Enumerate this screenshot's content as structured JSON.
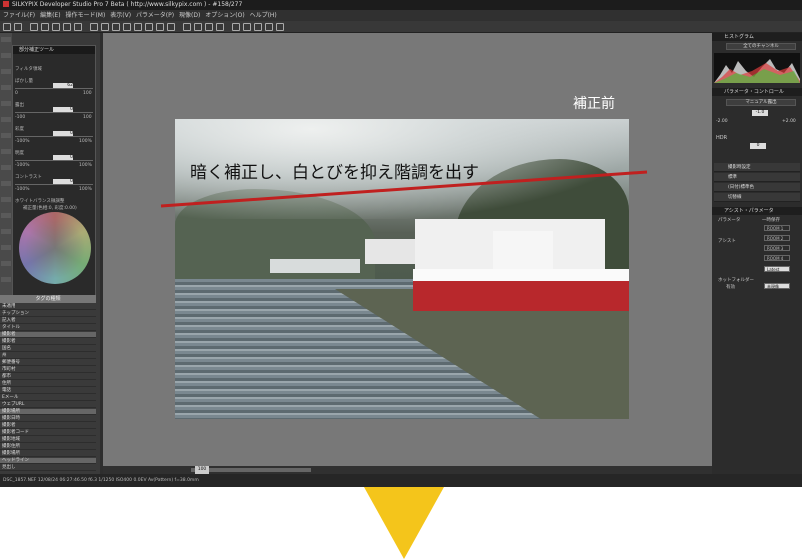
{
  "window": {
    "title": "SILKYPIX Developer Studio Pro 7 Beta ( http://www.silkypix.com ) - #158/277"
  },
  "menu": [
    "ファイル(F)",
    "編集(E)",
    "操作モード(M)",
    "表示(V)",
    "パラメータ(P)",
    "現像(D)",
    "オプション(O)",
    "ヘルプ(H)"
  ],
  "left_panel": {
    "title": "部分補正ツール",
    "filter_label": "フィルタ領域",
    "sliders": [
      {
        "label": "ぼかし量",
        "value": "62",
        "min": "0",
        "max": "100"
      },
      {
        "label": "露出",
        "value": "0",
        "min": "-100",
        "max": "100"
      },
      {
        "label": "彩度",
        "value": "0",
        "min": "-100%",
        "max": "100%"
      },
      {
        "label": "明度",
        "value": "0",
        "min": "-100%",
        "max": "100%"
      },
      {
        "label": "コントラスト",
        "value": "0",
        "min": "-100%",
        "max": "100%"
      }
    ],
    "wb_label": "ホワイトバランス微調整",
    "wb_value": "補正量(色相:0, 彩度:0.00)",
    "tag_header": "タグの種類",
    "tags": [
      "未適用",
      "チップション",
      "記入者",
      "タイトル",
      "撮影者",
      "撮影者",
      "国名",
      "州",
      "郵便番号",
      "市町村",
      "都市",
      "住所",
      "電話",
      "Eメール",
      "ウェブURL",
      "撮影場所",
      "撮影日時",
      "撮影者",
      "撮影者コード",
      "撮影地域",
      "撮影住所",
      "撮影場所",
      "ヘッドライン",
      "見出し"
    ]
  },
  "preview": {
    "overlay_caption": "暗く補正し、白とびを抑え階調を出す",
    "before_label": "補正前",
    "zoom": "100"
  },
  "right_panel": {
    "histogram_title": "ヒストグラム",
    "histogram_channel": "全てのチャンネル",
    "param_title": "パラメータ・コントロール",
    "exposure_mode": "マニュアル露出",
    "exposure_value": "-1.0",
    "exposure_min": "-2.00",
    "exposure_max": "+2.00",
    "hdr_label": "HDR",
    "hdr_value": "0",
    "rows": [
      "撮影時設定",
      "標準",
      "(日付)標準色",
      "切替線"
    ],
    "assist_title": "アシスト・パラメータ",
    "param_group": "パラメータ",
    "temp_group": "一時保存",
    "assist_group": "アシスト",
    "rooms": [
      "ROOM 1",
      "ROOM 2",
      "ROOM 3",
      "ROOM 4"
    ],
    "latest": "Latest",
    "hot_folder": "ホットフォルダー",
    "valid_label": "有効",
    "unprocessed": "未現像"
  },
  "status_bar": "DSC_1857.NEF 12/08/24 06:27:46.50 f6.3 1/1250 ISO400  0.0EV Av(Pattern) f=38.0mm",
  "colors": {
    "arrow": "#f4c51b",
    "guide_line": "#c0201f"
  }
}
